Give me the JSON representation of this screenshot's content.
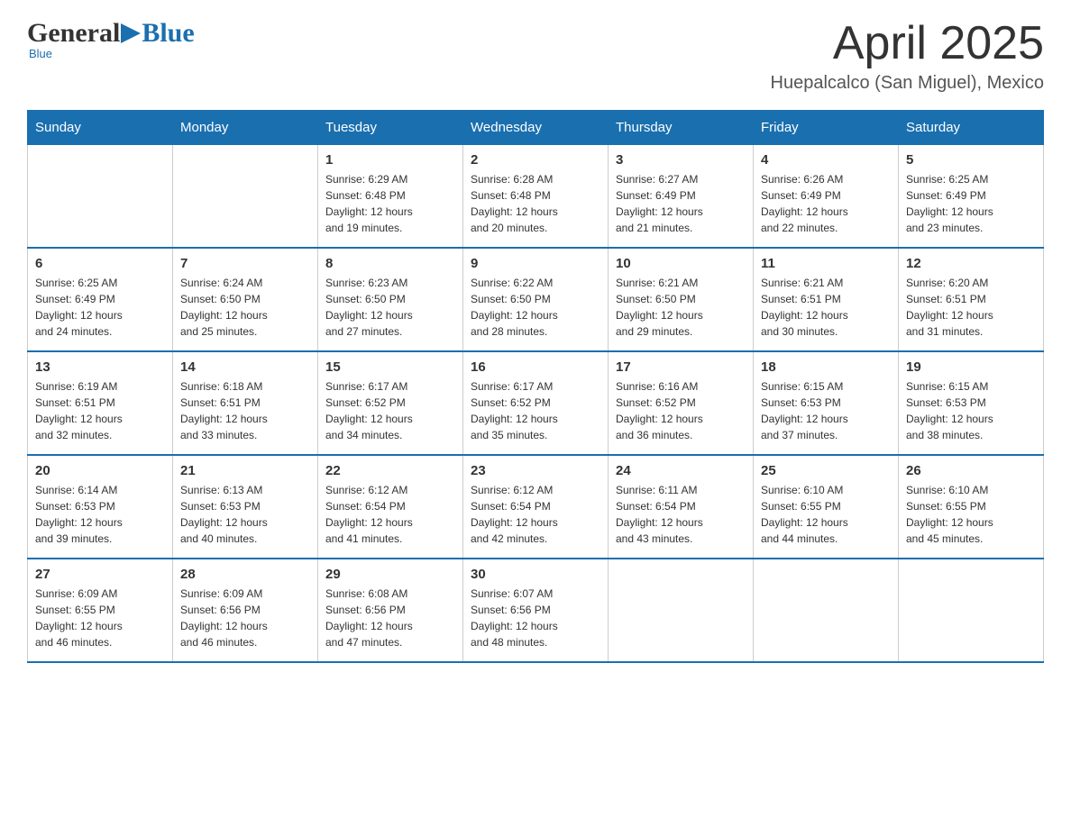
{
  "header": {
    "logo": {
      "general": "General",
      "arrow": "▶",
      "blue": "Blue",
      "tagline": "Blue"
    },
    "title": "April 2025",
    "location": "Huepalcalco (San Miguel), Mexico"
  },
  "calendar": {
    "columns": [
      "Sunday",
      "Monday",
      "Tuesday",
      "Wednesday",
      "Thursday",
      "Friday",
      "Saturday"
    ],
    "weeks": [
      {
        "days": [
          {
            "num": "",
            "info": ""
          },
          {
            "num": "",
            "info": ""
          },
          {
            "num": "1",
            "info": "Sunrise: 6:29 AM\nSunset: 6:48 PM\nDaylight: 12 hours\nand 19 minutes."
          },
          {
            "num": "2",
            "info": "Sunrise: 6:28 AM\nSunset: 6:48 PM\nDaylight: 12 hours\nand 20 minutes."
          },
          {
            "num": "3",
            "info": "Sunrise: 6:27 AM\nSunset: 6:49 PM\nDaylight: 12 hours\nand 21 minutes."
          },
          {
            "num": "4",
            "info": "Sunrise: 6:26 AM\nSunset: 6:49 PM\nDaylight: 12 hours\nand 22 minutes."
          },
          {
            "num": "5",
            "info": "Sunrise: 6:25 AM\nSunset: 6:49 PM\nDaylight: 12 hours\nand 23 minutes."
          }
        ]
      },
      {
        "days": [
          {
            "num": "6",
            "info": "Sunrise: 6:25 AM\nSunset: 6:49 PM\nDaylight: 12 hours\nand 24 minutes."
          },
          {
            "num": "7",
            "info": "Sunrise: 6:24 AM\nSunset: 6:50 PM\nDaylight: 12 hours\nand 25 minutes."
          },
          {
            "num": "8",
            "info": "Sunrise: 6:23 AM\nSunset: 6:50 PM\nDaylight: 12 hours\nand 27 minutes."
          },
          {
            "num": "9",
            "info": "Sunrise: 6:22 AM\nSunset: 6:50 PM\nDaylight: 12 hours\nand 28 minutes."
          },
          {
            "num": "10",
            "info": "Sunrise: 6:21 AM\nSunset: 6:50 PM\nDaylight: 12 hours\nand 29 minutes."
          },
          {
            "num": "11",
            "info": "Sunrise: 6:21 AM\nSunset: 6:51 PM\nDaylight: 12 hours\nand 30 minutes."
          },
          {
            "num": "12",
            "info": "Sunrise: 6:20 AM\nSunset: 6:51 PM\nDaylight: 12 hours\nand 31 minutes."
          }
        ]
      },
      {
        "days": [
          {
            "num": "13",
            "info": "Sunrise: 6:19 AM\nSunset: 6:51 PM\nDaylight: 12 hours\nand 32 minutes."
          },
          {
            "num": "14",
            "info": "Sunrise: 6:18 AM\nSunset: 6:51 PM\nDaylight: 12 hours\nand 33 minutes."
          },
          {
            "num": "15",
            "info": "Sunrise: 6:17 AM\nSunset: 6:52 PM\nDaylight: 12 hours\nand 34 minutes."
          },
          {
            "num": "16",
            "info": "Sunrise: 6:17 AM\nSunset: 6:52 PM\nDaylight: 12 hours\nand 35 minutes."
          },
          {
            "num": "17",
            "info": "Sunrise: 6:16 AM\nSunset: 6:52 PM\nDaylight: 12 hours\nand 36 minutes."
          },
          {
            "num": "18",
            "info": "Sunrise: 6:15 AM\nSunset: 6:53 PM\nDaylight: 12 hours\nand 37 minutes."
          },
          {
            "num": "19",
            "info": "Sunrise: 6:15 AM\nSunset: 6:53 PM\nDaylight: 12 hours\nand 38 minutes."
          }
        ]
      },
      {
        "days": [
          {
            "num": "20",
            "info": "Sunrise: 6:14 AM\nSunset: 6:53 PM\nDaylight: 12 hours\nand 39 minutes."
          },
          {
            "num": "21",
            "info": "Sunrise: 6:13 AM\nSunset: 6:53 PM\nDaylight: 12 hours\nand 40 minutes."
          },
          {
            "num": "22",
            "info": "Sunrise: 6:12 AM\nSunset: 6:54 PM\nDaylight: 12 hours\nand 41 minutes."
          },
          {
            "num": "23",
            "info": "Sunrise: 6:12 AM\nSunset: 6:54 PM\nDaylight: 12 hours\nand 42 minutes."
          },
          {
            "num": "24",
            "info": "Sunrise: 6:11 AM\nSunset: 6:54 PM\nDaylight: 12 hours\nand 43 minutes."
          },
          {
            "num": "25",
            "info": "Sunrise: 6:10 AM\nSunset: 6:55 PM\nDaylight: 12 hours\nand 44 minutes."
          },
          {
            "num": "26",
            "info": "Sunrise: 6:10 AM\nSunset: 6:55 PM\nDaylight: 12 hours\nand 45 minutes."
          }
        ]
      },
      {
        "days": [
          {
            "num": "27",
            "info": "Sunrise: 6:09 AM\nSunset: 6:55 PM\nDaylight: 12 hours\nand 46 minutes."
          },
          {
            "num": "28",
            "info": "Sunrise: 6:09 AM\nSunset: 6:56 PM\nDaylight: 12 hours\nand 46 minutes."
          },
          {
            "num": "29",
            "info": "Sunrise: 6:08 AM\nSunset: 6:56 PM\nDaylight: 12 hours\nand 47 minutes."
          },
          {
            "num": "30",
            "info": "Sunrise: 6:07 AM\nSunset: 6:56 PM\nDaylight: 12 hours\nand 48 minutes."
          },
          {
            "num": "",
            "info": ""
          },
          {
            "num": "",
            "info": ""
          },
          {
            "num": "",
            "info": ""
          }
        ]
      }
    ]
  }
}
